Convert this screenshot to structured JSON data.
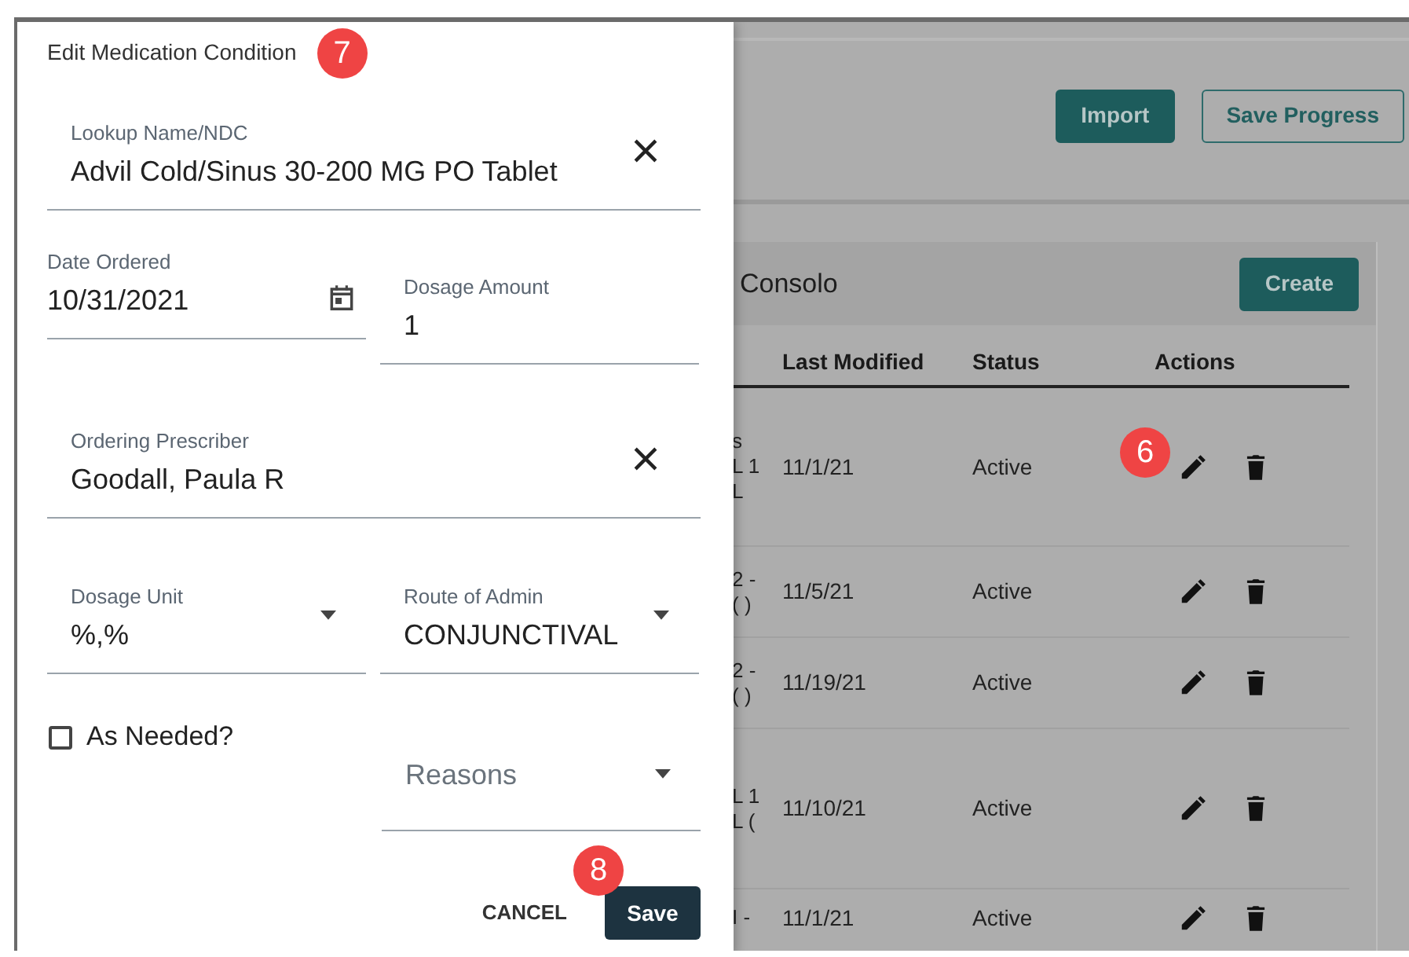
{
  "toolbar": {
    "buttons": [
      {
        "kind": "primary",
        "label": "Import"
      },
      {
        "kind": "outline",
        "label": "Save Progress"
      }
    ]
  },
  "card": {
    "title": "Consolo",
    "create_button": "Create",
    "table": {
      "columns": [
        "Last Modified",
        "Status",
        "Actions"
      ],
      "rows": [
        {
          "column_1": [
            "s",
            "L 1",
            "L"
          ],
          "last_modified": "11/1/21",
          "status": "Active",
          "marker": "6"
        },
        {
          "column_1": [
            "2 -",
            "( )"
          ],
          "last_modified": "11/5/21",
          "status": "Active"
        },
        {
          "column_1": [
            "2 -",
            "( )"
          ],
          "last_modified": "11/19/21",
          "status": "Active"
        },
        {
          "column_1": [
            "L 1",
            "L ("
          ],
          "last_modified": "11/10/21",
          "status": "Active"
        },
        {
          "column_1": [
            "I -"
          ],
          "last_modified": "11/1/21",
          "status": "Active"
        }
      ]
    }
  },
  "dialog": {
    "title": "Edit Medication Condition",
    "marker": "7",
    "fields": [
      {
        "kind": "autocomplete",
        "label": "Lookup Name/NDC",
        "value": "Advil Cold/Sinus 30-200 MG PO Tablet"
      },
      {
        "kind": "date",
        "label": "Date Ordered",
        "value": "10/31/2021"
      },
      {
        "kind": "text",
        "label": "Dosage Amount",
        "value": "1"
      },
      {
        "kind": "autocomplete",
        "label": "Ordering Prescriber",
        "value": "Goodall, Paula R"
      },
      {
        "kind": "select",
        "label": "Dosage Unit",
        "value": "%,%"
      },
      {
        "kind": "select",
        "label": "Route of Admin",
        "value": "CONJUNCTIVAL"
      },
      {
        "kind": "checkbox",
        "label": "As Needed?",
        "checked": false
      },
      {
        "kind": "select",
        "placeholder": "Reasons"
      }
    ],
    "buttons": [
      {
        "kind": "text",
        "label": "CANCEL"
      },
      {
        "kind": "primary",
        "label": "Save",
        "marker": "8"
      }
    ]
  }
}
